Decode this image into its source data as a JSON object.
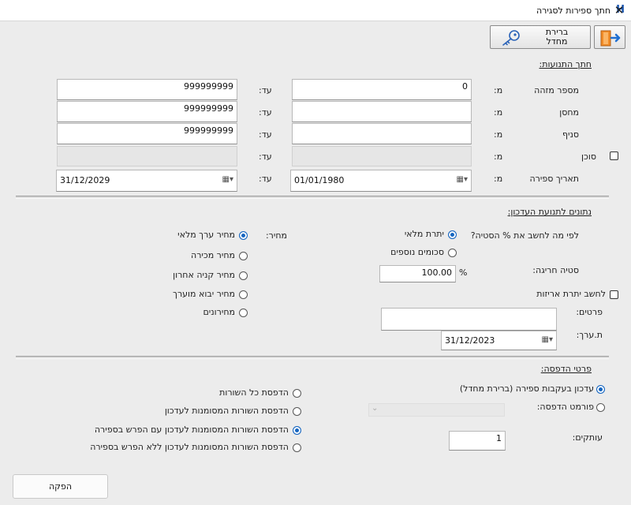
{
  "window": {
    "title": "חתך ספירות לסגירה",
    "close_symbol": "✕",
    "app_icon": "H"
  },
  "toolbar": {
    "query_label_line1": "ברירת",
    "query_label_line2": "מחדל"
  },
  "section_items": {
    "title": "חתך התנועות:",
    "from_label": "מ:",
    "to_label": "עד:",
    "rows": [
      {
        "label": "מספר מזהה",
        "from_value": "0",
        "to_value": "999999999"
      },
      {
        "label": "מחסן",
        "from_value": "",
        "to_value": "999999999"
      },
      {
        "label": "סניף",
        "from_value": "",
        "to_value": "999999999"
      },
      {
        "label": "סוכן",
        "from_value": "",
        "to_value": ""
      },
      {
        "label": "תאריך ספירה",
        "from_value": "01/01/1980",
        "to_value": "31/12/2029"
      }
    ]
  },
  "section_update": {
    "title": "נתונים לתנועת העדכון:",
    "percent_question": "לפי מה לחשב את % הסטיה?",
    "percent_options": [
      {
        "label": "יתרת מלאי",
        "checked": true
      },
      {
        "label": "סכומים נוספים",
        "checked": false
      }
    ],
    "price_label": "מחיר:",
    "price_options": [
      {
        "label": "מחיר ערך מלאי",
        "checked": true
      },
      {
        "label": "מחיר מכירה",
        "checked": false
      },
      {
        "label": "מחיר קניה אחרון",
        "checked": false
      },
      {
        "label": "מחיר יבוא מוערך",
        "checked": false
      },
      {
        "label": "מחירונים",
        "checked": false
      }
    ],
    "deviation_label": "סטיה חריגה:",
    "deviation_value": "100.00",
    "percent_sign": "%",
    "pack_balance_label": "לחשב יתרת אריזות",
    "details_label": "פרטים:",
    "details_value": "",
    "value_date_label": "ת.ערך:",
    "value_date": "31/12/2023"
  },
  "section_print": {
    "title": "פרטי הדפסה:",
    "mode_options": [
      {
        "label": "עדכון בעקבות ספירה (ברירת מחדל)",
        "checked": true
      },
      {
        "label": "פורמט הדפסה:",
        "checked": false
      }
    ],
    "copies_label": "עותקים:",
    "copies_value": "1",
    "print_options": [
      {
        "label": "הדפסת כל השורות",
        "checked": false
      },
      {
        "label": "הדפסת השורות המסומנות לעדכון",
        "checked": false
      },
      {
        "label": "הדפסת השורות המסומנות לעדכון עם הפרש בספירה",
        "checked": true
      },
      {
        "label": "הדפסת השורות המסומנות לעדכון ללא הפרש בספירה",
        "checked": false
      }
    ]
  },
  "footer": {
    "produce_label": "הפקה"
  },
  "colors": {
    "accent": "#1565c0",
    "background": "#ececec",
    "field_bg": "#ffffff"
  },
  "icons": [
    "app-logo-icon",
    "close-icon",
    "exit-door-icon",
    "key-icon",
    "calendar-icon",
    "dropdown-chevron-icon"
  ]
}
